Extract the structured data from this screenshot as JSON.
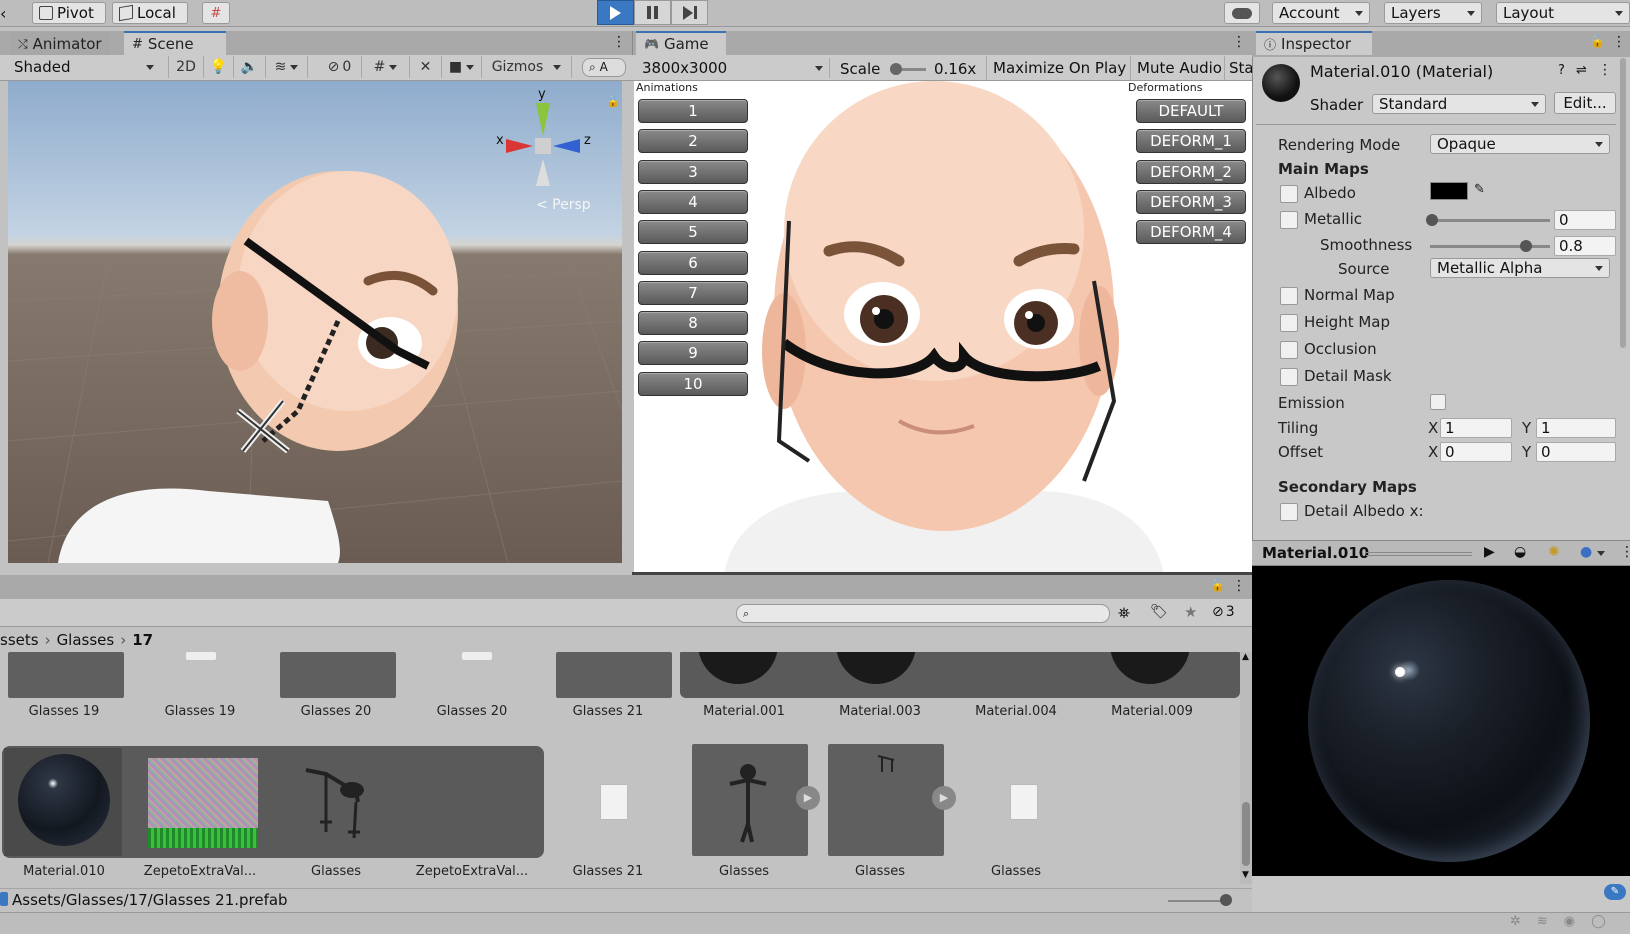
{
  "toolbar": {
    "pivot_label": "Pivot",
    "local_label": "Local",
    "account_label": "Account",
    "layers_label": "Layers",
    "layout_label": "Layout"
  },
  "scene_panel": {
    "tab_animator": "Animator",
    "tab_scene": "Scene",
    "shading_mode": "Shaded",
    "mode_2d": "2D",
    "hidden_count": "0",
    "gizmos_label": "Gizmos",
    "search_glyph": "A",
    "gizmo_x": "x",
    "gizmo_y": "y",
    "gizmo_z": "z",
    "persp_label": "< Persp"
  },
  "game_panel": {
    "tab_game": "Game",
    "resolution": "3800x3000",
    "scale_label": "Scale",
    "scale_value": "0.16x",
    "maximize_label": "Maximize On Play",
    "mute_label": "Mute Audio",
    "stats_label": "Sta",
    "animations_title": "Animations",
    "deformations_title": "Deformations",
    "animation_buttons": [
      "1",
      "2",
      "3",
      "4",
      "5",
      "6",
      "7",
      "8",
      "9",
      "10"
    ],
    "deformation_buttons": [
      "DEFAULT",
      "DEFORM_1",
      "DEFORM_2",
      "DEFORM_3",
      "DEFORM_4"
    ]
  },
  "inspector": {
    "tab_label": "Inspector",
    "material_name": "Material.010 (Material)",
    "shader_label": "Shader",
    "shader_value": "Standard",
    "edit_button": "Edit...",
    "rendering_mode_label": "Rendering Mode",
    "rendering_mode_value": "Opaque",
    "main_maps_label": "Main Maps",
    "albedo_label": "Albedo",
    "albedo_color": "#000000",
    "metallic_label": "Metallic",
    "metallic_value": "0",
    "smoothness_label": "Smoothness",
    "smoothness_value": "0.8",
    "source_label": "Source",
    "source_value": "Metallic Alpha",
    "normal_map_label": "Normal Map",
    "height_map_label": "Height Map",
    "occlusion_label": "Occlusion",
    "detail_mask_label": "Detail Mask",
    "emission_label": "Emission",
    "tiling_label": "Tiling",
    "tiling_x": "1",
    "tiling_y": "1",
    "offset_label": "Offset",
    "offset_x": "0",
    "offset_y": "0",
    "x_label": "X",
    "y_label": "Y",
    "secondary_maps_label": "Secondary Maps",
    "detail_albedo_label": "Detail Albedo x:",
    "preview_title": "Material.010"
  },
  "project": {
    "breadcrumb": [
      "ssets",
      "Glasses",
      "17"
    ],
    "hidden_count": "3",
    "row1": [
      "Glasses 19",
      "Glasses 19",
      "Glasses 20",
      "Glasses 20",
      "Glasses 21",
      "Material.001",
      "Material.003",
      "Material.004",
      "Material.009"
    ],
    "row2": [
      "Material.010",
      "ZepetoExtraVal...",
      "Glasses",
      "ZepetoExtraVal...",
      "Glasses 21",
      "Glasses",
      "Glasses",
      "Glasses"
    ],
    "status_path": "Assets/Glasses/17/Glasses 21.prefab"
  },
  "colors": {
    "play_accent": "#3b78c2",
    "panel_bg": "#c2c2c2",
    "tab_active_border": "#3a72b0",
    "game_button_dark": "#5a5a5a"
  }
}
